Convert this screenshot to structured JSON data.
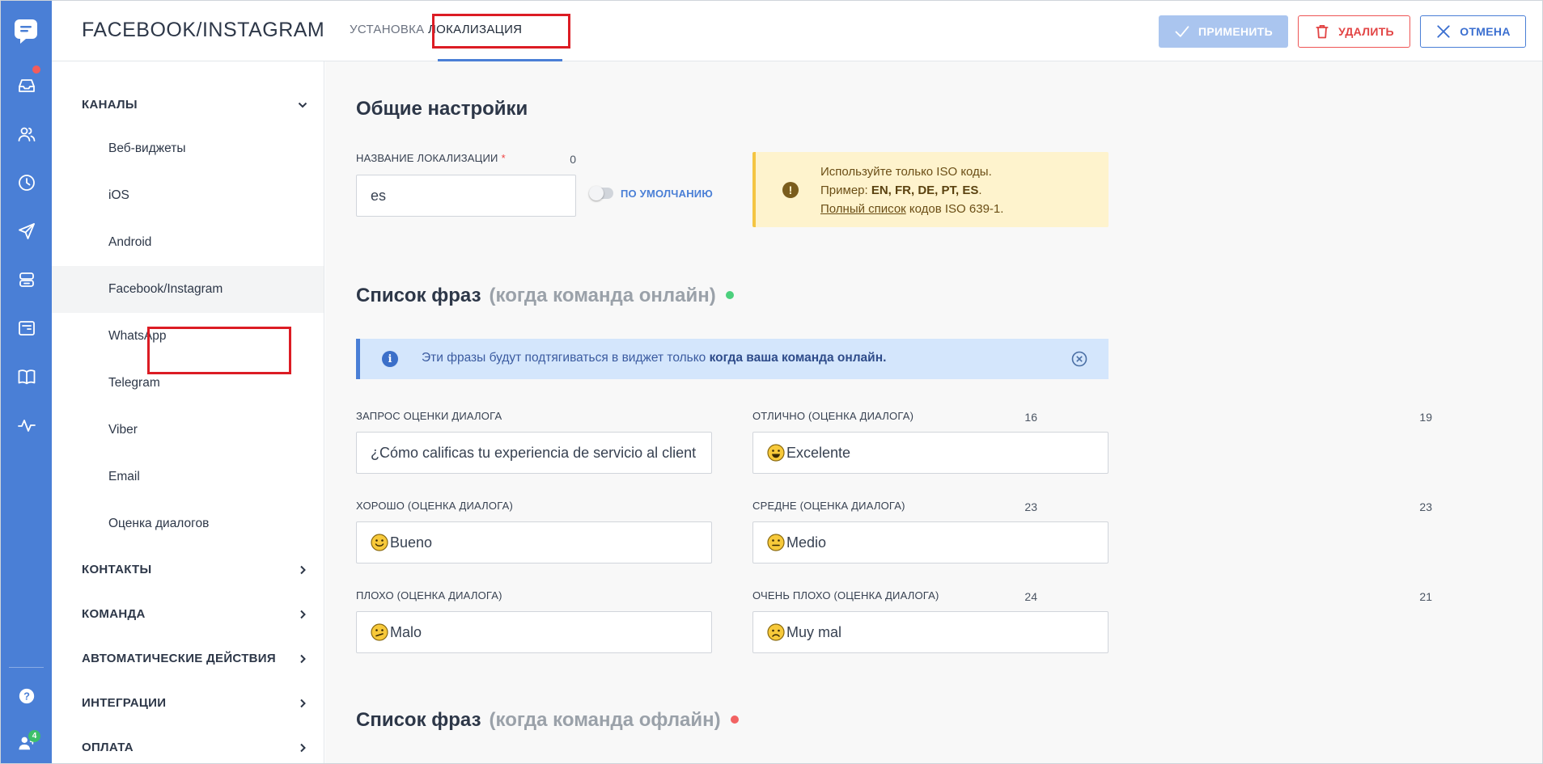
{
  "app": {
    "title": "FACEBOOK/INSTAGRAM",
    "tabs": [
      "УСТАНОВКА",
      "ЛОКАЛИЗАЦИЯ"
    ],
    "active_tab": "ЛОКАЛИЗАЦИЯ"
  },
  "actions": {
    "apply": "ПРИМЕНИТЬ",
    "delete": "УДАЛИТЬ",
    "cancel": "ОТМЕНА"
  },
  "rail": {
    "icons": [
      "chat-logo-icon",
      "inbox-icon",
      "contacts-icon",
      "history-icon",
      "send-icon",
      "database-icon",
      "widget-icon",
      "book-icon",
      "activity-icon",
      "help-icon",
      "user-icon"
    ],
    "badge": "4",
    "colors": {
      "rail": "#4a7fd6",
      "notification": "#f25c5c",
      "badge": "#3dbf6a"
    }
  },
  "sidebar": {
    "channels": {
      "title": "КАНАЛЫ",
      "items": [
        "Веб-виджеты",
        "iOS",
        "Android",
        "Facebook/Instagram",
        "WhatsApp",
        "Telegram",
        "Viber",
        "Email",
        "Оценка диалогов"
      ],
      "active": "Facebook/Instagram"
    },
    "sections": [
      "КОНТАКТЫ",
      "КОМАНДА",
      "АВТОМАТИЧЕСКИЕ ДЕЙСТВИЯ",
      "ИНТЕГРАЦИИ",
      "ОПЛАТА"
    ]
  },
  "general": {
    "heading": "Общие настройки",
    "name_label": "НАЗВАНИЕ ЛОКАЛИЗАЦИИ",
    "required_mark": "*",
    "name_count": "0",
    "name_value": "es",
    "default_toggle": "ПО УМОЛЧАНИЮ",
    "warning": {
      "line1": "Используйте только ISO коды.",
      "line2_prefix": "Пример: ",
      "line2_codes": "EN, FR, DE, PT, ES",
      "line2_suffix": ".",
      "link": "Полный список",
      "line3_suffix": " кодов ISO 639-1."
    }
  },
  "online": {
    "heading": "Список фраз",
    "heading_muted": "(когда команда онлайн)",
    "status_color": "#4cd07d",
    "info_prefix": "Эти фразы будут подтягиваться в виджет только ",
    "info_bold": "когда ваша команда онлайн.",
    "fields": [
      {
        "label": "ЗАПРОС ОЦЕНКИ ДИАЛОГА",
        "count": "16",
        "value": "¿Cómo calificas tu experiencia de servicio al client",
        "emoji": ""
      },
      {
        "label": "ОТЛИЧНО (ОЦЕНКА ДИАЛОГА)",
        "count": "19",
        "value": "Excelente",
        "emoji": "grin-emoji"
      },
      {
        "label": "ХОРОШО (ОЦЕНКА ДИАЛОГА)",
        "count": "23",
        "value": "Bueno",
        "emoji": "smile-emoji"
      },
      {
        "label": "СРЕДНЕ (ОЦЕНКА ДИАЛОГА)",
        "count": "23",
        "value": "Medio",
        "emoji": "neutral-emoji"
      },
      {
        "label": "ПЛОХО (ОЦЕНКА ДИАЛОГА)",
        "count": "24",
        "value": "Malo",
        "emoji": "confused-emoji"
      },
      {
        "label": "ОЧЕНЬ ПЛОХО (ОЦЕНКА ДИАЛОГА)",
        "count": "21",
        "value": "Muy mal",
        "emoji": "sad-emoji"
      }
    ]
  },
  "offline": {
    "heading": "Список фраз",
    "heading_muted": "(когда команда офлайн)",
    "status_color": "#f26262"
  }
}
